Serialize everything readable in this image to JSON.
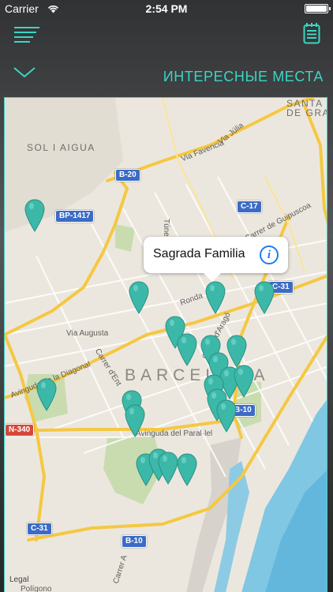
{
  "status_bar": {
    "carrier": "Carrier",
    "time": "2:54 PM"
  },
  "nav": {
    "menu_icon": "menu-lines-icon",
    "notes_icon": "notepad-icon",
    "accent_color": "#3ad6c4"
  },
  "header": {
    "chevron_icon": "chevron-down-icon",
    "title": "ИНТЕРЕСНЫЕ МЕСТА"
  },
  "map": {
    "city_label": "BARCELONA",
    "district_labels": [
      "SOL I AIGUA",
      "SANTA C",
      "DE GRAC"
    ],
    "road_labels": [
      "Via Favencia",
      "Via Júlia",
      "Via Augusta",
      "Carrer d'Ent",
      "Avinguda de la Diagonal",
      "Avinguda del Paral·lel",
      "Carrer de Guipuscoa",
      "Túnel",
      "Carrer d'Aragó",
      "Ronda",
      "Polígono",
      "Carrer A"
    ],
    "route_shields": [
      "B-20",
      "BP-1417",
      "C-17",
      "C-31",
      "B-10",
      "N-340",
      "C-31",
      "B-10"
    ],
    "legal_label": "Legal",
    "pin_color": "#3cb8a9",
    "callout": {
      "title": "Sagrada Familia",
      "info_icon": "info-icon"
    }
  }
}
